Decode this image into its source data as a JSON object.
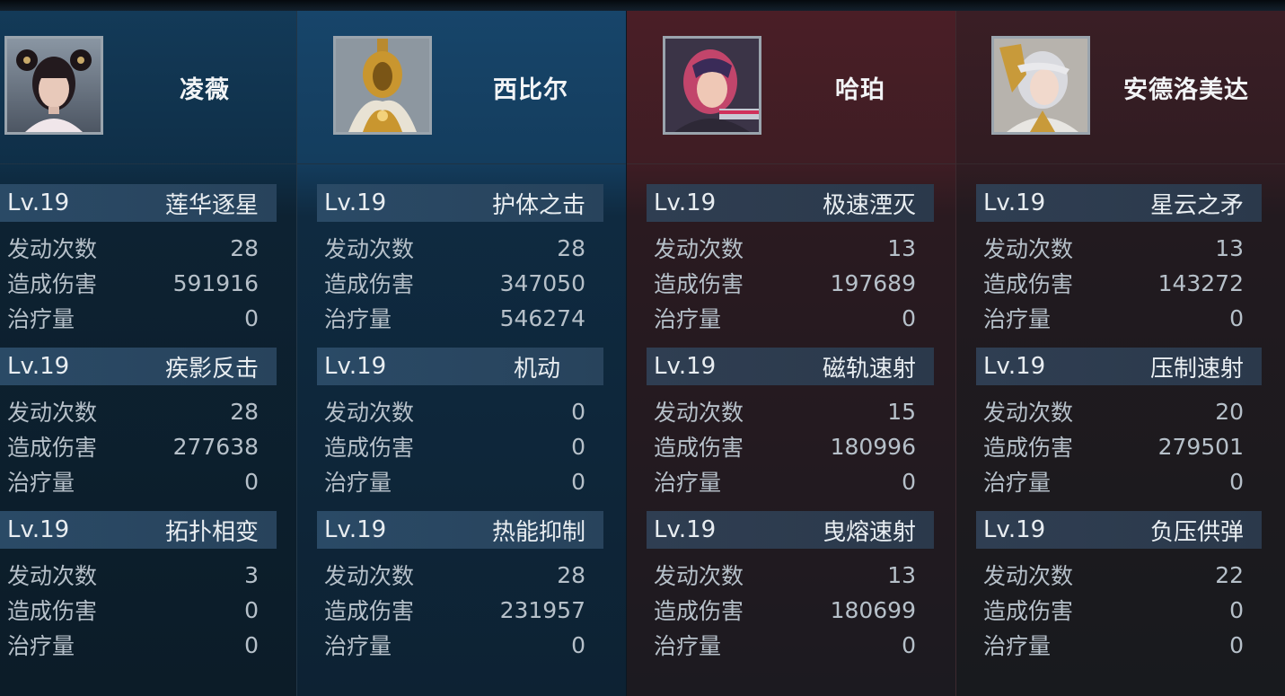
{
  "characters": [
    {
      "name": "凌薇",
      "skills": [
        {
          "level": "Lv.19",
          "name": "莲华逐星",
          "stats": [
            {
              "label": "发动次数",
              "value": "28"
            },
            {
              "label": "造成伤害",
              "value": "591916"
            },
            {
              "label": "治疗量",
              "value": "0"
            }
          ]
        },
        {
          "level": "Lv.19",
          "name": "疾影反击",
          "stats": [
            {
              "label": "发动次数",
              "value": "28"
            },
            {
              "label": "造成伤害",
              "value": "277638"
            },
            {
              "label": "治疗量",
              "value": "0"
            }
          ]
        },
        {
          "level": "Lv.19",
          "name": "拓扑相变",
          "stats": [
            {
              "label": "发动次数",
              "value": "3"
            },
            {
              "label": "造成伤害",
              "value": "0"
            },
            {
              "label": "治疗量",
              "value": "0"
            }
          ]
        }
      ]
    },
    {
      "name": "西比尔",
      "skills": [
        {
          "level": "Lv.19",
          "name": "护体之击",
          "stats": [
            {
              "label": "发动次数",
              "value": "28"
            },
            {
              "label": "造成伤害",
              "value": "347050"
            },
            {
              "label": "治疗量",
              "value": "546274"
            }
          ]
        },
        {
          "level": "Lv.19",
          "name": "机动",
          "stats": [
            {
              "label": "发动次数",
              "value": "0"
            },
            {
              "label": "造成伤害",
              "value": "0"
            },
            {
              "label": "治疗量",
              "value": "0"
            }
          ]
        },
        {
          "level": "Lv.19",
          "name": "热能抑制",
          "stats": [
            {
              "label": "发动次数",
              "value": "28"
            },
            {
              "label": "造成伤害",
              "value": "231957"
            },
            {
              "label": "治疗量",
              "value": "0"
            }
          ]
        }
      ]
    },
    {
      "name": "哈珀",
      "skills": [
        {
          "level": "Lv.19",
          "name": "极速湮灭",
          "stats": [
            {
              "label": "发动次数",
              "value": "13"
            },
            {
              "label": "造成伤害",
              "value": "197689"
            },
            {
              "label": "治疗量",
              "value": "0"
            }
          ]
        },
        {
          "level": "Lv.19",
          "name": "磁轨速射",
          "stats": [
            {
              "label": "发动次数",
              "value": "15"
            },
            {
              "label": "造成伤害",
              "value": "180996"
            },
            {
              "label": "治疗量",
              "value": "0"
            }
          ]
        },
        {
          "level": "Lv.19",
          "name": "曳熔速射",
          "stats": [
            {
              "label": "发动次数",
              "value": "13"
            },
            {
              "label": "造成伤害",
              "value": "180699"
            },
            {
              "label": "治疗量",
              "value": "0"
            }
          ]
        }
      ]
    },
    {
      "name": "安德洛美达",
      "skills": [
        {
          "level": "Lv.19",
          "name": "星云之矛",
          "stats": [
            {
              "label": "发动次数",
              "value": "13"
            },
            {
              "label": "造成伤害",
              "value": "143272"
            },
            {
              "label": "治疗量",
              "value": "0"
            }
          ]
        },
        {
          "level": "Lv.19",
          "name": "压制速射",
          "stats": [
            {
              "label": "发动次数",
              "value": "20"
            },
            {
              "label": "造成伤害",
              "value": "279501"
            },
            {
              "label": "治疗量",
              "value": "0"
            }
          ]
        },
        {
          "level": "Lv.19",
          "name": "负压供弹",
          "stats": [
            {
              "label": "发动次数",
              "value": "22"
            },
            {
              "label": "造成伤害",
              "value": "0"
            },
            {
              "label": "治疗量",
              "value": "0"
            }
          ]
        }
      ]
    }
  ],
  "theme": {
    "team_left_color": "#133a58",
    "team_right_color": "#4a1e26",
    "avatar_border_color": "#9aa4ad"
  }
}
